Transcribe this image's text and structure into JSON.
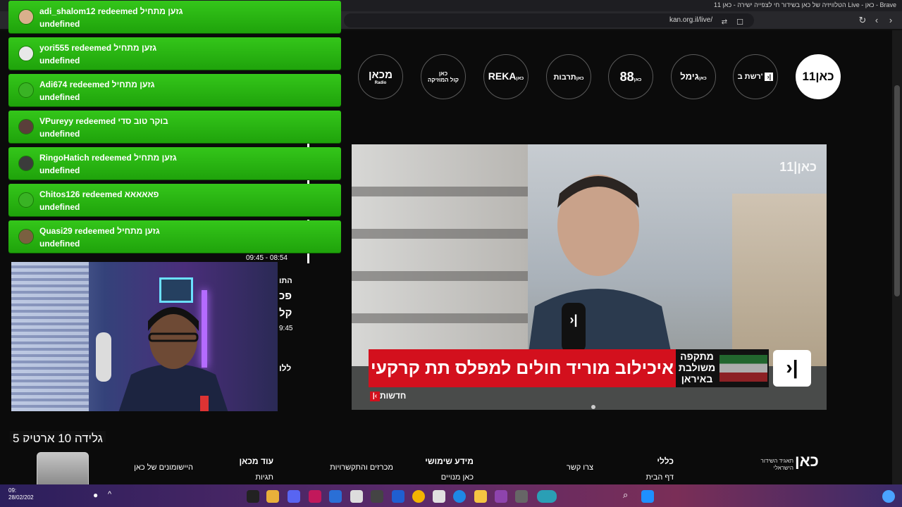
{
  "window": {
    "title": "הטלוויזיה של כאן בשידור חי לצפייה ישירה - כאן 11 Live - כאן - Brave",
    "url": "kan.org.il/live/"
  },
  "channels": [
    {
      "label": "מכאן",
      "sub": "Radio"
    },
    {
      "label": "כאן",
      "sub": "קול המוזיקה"
    },
    {
      "label": "REKA",
      "sub": "כאן"
    },
    {
      "label": "כאן",
      "sub": "תרבות"
    },
    {
      "label": "88",
      "sub": "כאן"
    },
    {
      "label": "גימל",
      "sub": "כאן"
    },
    {
      "label": "רשת ב'",
      "sub": ""
    },
    {
      "label": "כאן11",
      "sub": ""
    }
  ],
  "video": {
    "watermark": "כאן|11",
    "headline": "איכילוב מוריד חולים למפלס תת קרקעי",
    "tag": "מתקפה משולבת באיראן",
    "channel_badge": "חדשות"
  },
  "program": {
    "time_range": "09:45 - 08:54",
    "fragments": [
      "התו",
      "פכ",
      "קל",
      "9:45",
      "ללו"
    ]
  },
  "alerts": [
    {
      "user": "adi_shalom12",
      "reward": "גזען מתחיל",
      "detail": "undefined"
    },
    {
      "user": "yori555",
      "reward": "גזען מתחיל",
      "detail": "undefined"
    },
    {
      "user": "Adi674",
      "reward": "גזען מתחיל",
      "detail": "undefined"
    },
    {
      "user": "VPureyy",
      "reward": "בוקר טוב סדי",
      "detail": "undefined"
    },
    {
      "user": "RingoHatich",
      "reward": "גזען מתחיל",
      "detail": "undefined"
    },
    {
      "user": "Chitos126",
      "reward": "פאאאאא",
      "detail": "undefined"
    },
    {
      "user": "Quasi29",
      "reward": "גזען מתחיל",
      "detail": "undefined"
    }
  ],
  "alert_verb": "redeemed",
  "caption": "גלידה 10 ארטיק 5",
  "footer": {
    "columns": [
      {
        "head": "כללי",
        "items": [
          "דף הבית"
        ]
      },
      {
        "head": "",
        "items": [
          "צרו קשר"
        ]
      },
      {
        "head": "מידע שימושי",
        "items": [
          "כאן מנויים"
        ]
      },
      {
        "head": "",
        "items": [
          "מכרזים והתקשרויות"
        ]
      },
      {
        "head": "עוד מכאן",
        "items": [
          "תגיות"
        ]
      },
      {
        "head": "",
        "items": [
          "היישומונים של כאן"
        ]
      }
    ],
    "logo": "כאן",
    "logo_sub": "תאגיד השידור הישראלי"
  },
  "taskbar": {
    "clock_time": "09:",
    "clock_date": "28/02/202"
  },
  "colors": {
    "alert_green": "#22a80d",
    "chyron_red": "#d3101d"
  }
}
